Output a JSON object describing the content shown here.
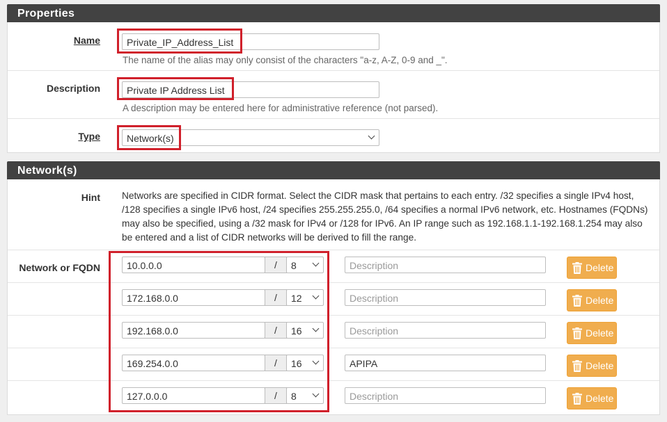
{
  "properties": {
    "section_title": "Properties",
    "name": {
      "label": "Name",
      "value": "Private_IP_Address_List",
      "help": "The name of the alias may only consist of the characters \"a-z, A-Z, 0-9 and _\"."
    },
    "description": {
      "label": "Description",
      "value": "Private IP Address List",
      "help": "A description may be entered here for administrative reference (not parsed)."
    },
    "type": {
      "label": "Type",
      "selected": "Network(s)"
    }
  },
  "networks": {
    "section_title": "Network(s)",
    "hint_label": "Hint",
    "hint_text": "Networks are specified in CIDR format. Select the CIDR mask that pertains to each entry. /32 specifies a single IPv4 host, /128 specifies a single IPv6 host, /24 specifies 255.255.255.0, /64 specifies a normal IPv6 network, etc. Hostnames (FQDNs) may also be specified, using a /32 mask for IPv4 or /128 for IPv6. An IP range such as 192.168.1.1-192.168.1.254 may also be entered and a list of CIDR networks will be derived to fill the range.",
    "row_label": "Network or FQDN",
    "slash": "/",
    "description_placeholder": "Description",
    "delete_label": "Delete",
    "entries": [
      {
        "address": "10.0.0.0",
        "mask": "8",
        "description": ""
      },
      {
        "address": "172.168.0.0",
        "mask": "12",
        "description": ""
      },
      {
        "address": "192.168.0.0",
        "mask": "16",
        "description": ""
      },
      {
        "address": "169.254.0.0",
        "mask": "16",
        "description": "APIPA"
      },
      {
        "address": "127.0.0.0",
        "mask": "8",
        "description": ""
      }
    ]
  },
  "colors": {
    "header_bg": "#424242",
    "delete_button": "#f0ad4e",
    "highlight": "#d0202b"
  }
}
